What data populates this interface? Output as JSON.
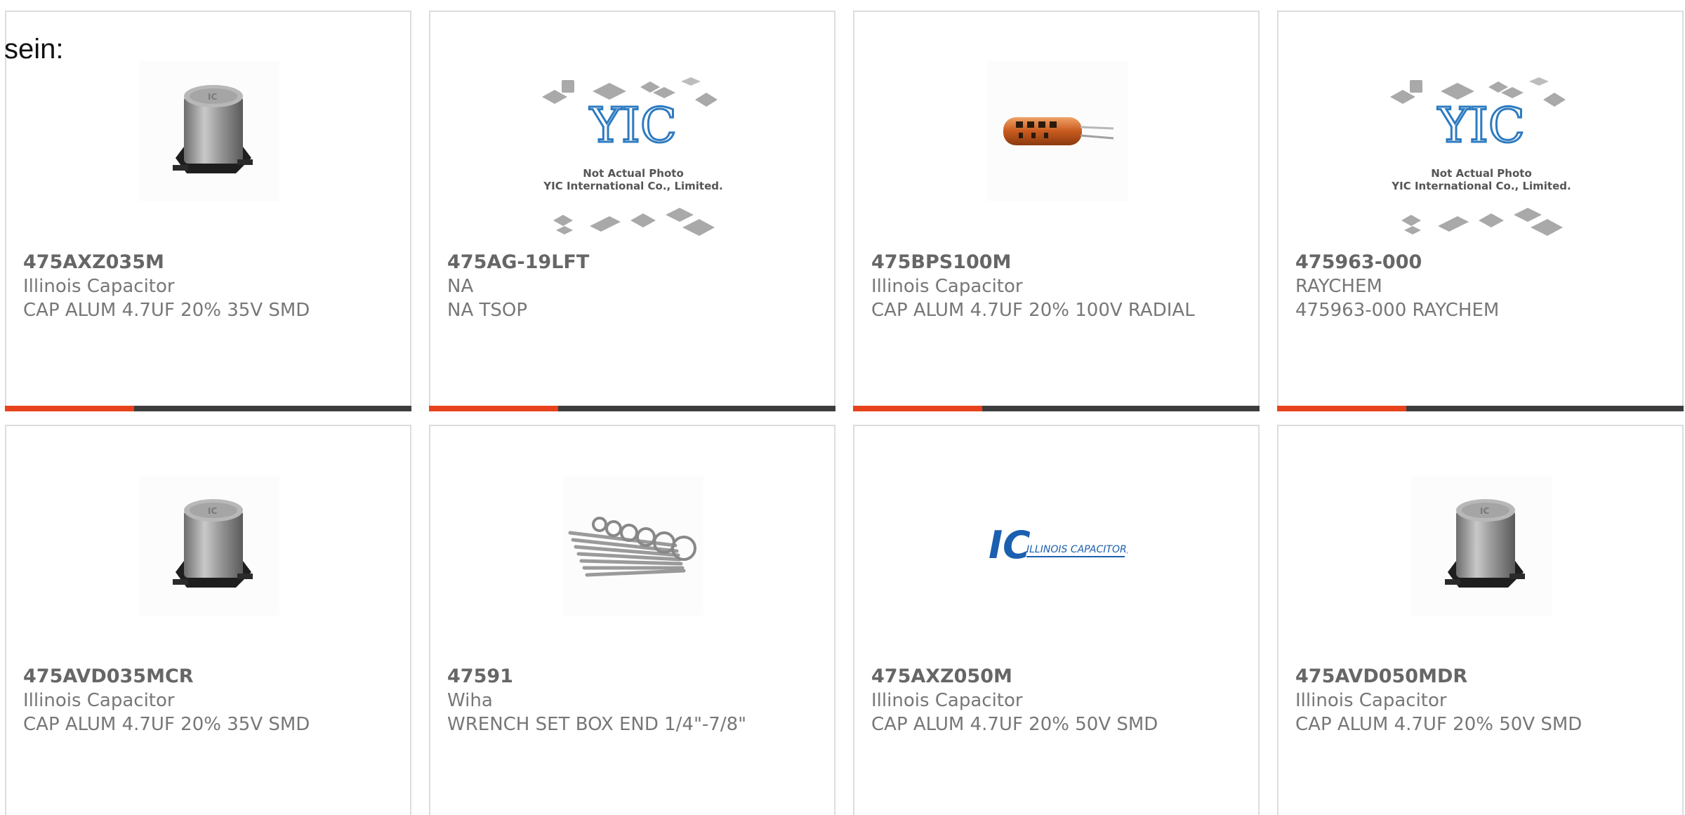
{
  "heading_fragment": "sein:",
  "colors": {
    "accent": "#e8421c",
    "bar_dark": "#3d3d3d",
    "card_border": "#dddddd",
    "text": "#666666"
  },
  "cards": [
    {
      "part_number": "475AXZ035M",
      "manufacturer": "Illinois Capacitor",
      "description": "CAP ALUM 4.7UF 20% 35V SMD",
      "image": "smd-electrolytic-capacitor-image"
    },
    {
      "part_number": "475AG-19LFT",
      "manufacturer": "NA",
      "description": "NA TSOP",
      "image": "yic-placeholder-image",
      "placeholder_line1": "Not Actual Photo",
      "placeholder_line2": "YIC International Co., Limited.",
      "placeholder_logo": "YIC"
    },
    {
      "part_number": "475BPS100M",
      "manufacturer": "Illinois Capacitor",
      "description": "CAP ALUM 4.7UF 20% 100V RADIAL",
      "image": "radial-capacitor-image"
    },
    {
      "part_number": "475963-000",
      "manufacturer": "RAYCHEM",
      "description": "475963-000 RAYCHEM",
      "image": "yic-placeholder-image",
      "placeholder_line1": "Not Actual Photo",
      "placeholder_line2": "YIC International Co., Limited.",
      "placeholder_logo": "YIC"
    },
    {
      "part_number": "475AVD035MCR",
      "manufacturer": "Illinois Capacitor",
      "description": "CAP ALUM 4.7UF 20% 35V SMD",
      "image": "smd-electrolytic-capacitor-image"
    },
    {
      "part_number": "47591",
      "manufacturer": "Wiha",
      "description": "WRENCH SET BOX END 1/4\"-7/8\"",
      "image": "wrench-set-image"
    },
    {
      "part_number": "475AXZ050M",
      "manufacturer": "Illinois Capacitor",
      "description": "CAP ALUM 4.7UF 20% 50V SMD",
      "image": "illinois-capacitor-logo-image",
      "logo_mark": "IC",
      "logo_text": "ILLINOIS CAPACITOR, INC."
    },
    {
      "part_number": "475AVD050MDR",
      "manufacturer": "Illinois Capacitor",
      "description": "CAP ALUM 4.7UF 20% 50V SMD",
      "image": "smd-electrolytic-capacitor-image"
    }
  ]
}
